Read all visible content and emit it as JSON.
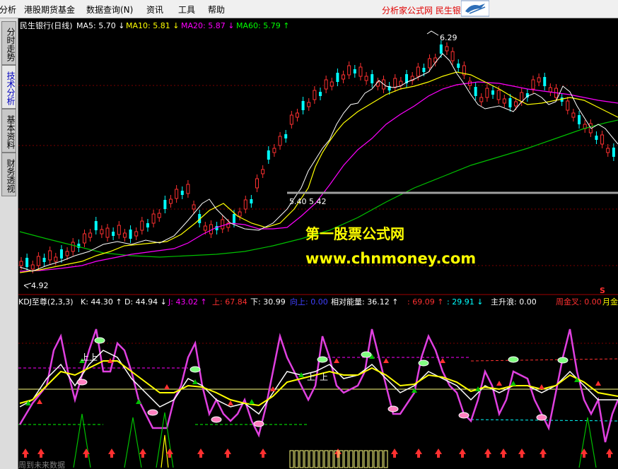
{
  "menu": {
    "items": [
      "分析",
      "港股期货基金",
      "数据查询(N)",
      "资讯",
      "工具",
      "帮助"
    ]
  },
  "brand": {
    "text": "分析家公式网 民生银行"
  },
  "sidebar": {
    "tabs": [
      "分时走势",
      "技术分析",
      "基本资料",
      "财务透视"
    ],
    "active": "技术分析"
  },
  "price_panel": {
    "stock_name": "民生银行(日线)",
    "ma": [
      {
        "label": "MA5:",
        "value": "5.70",
        "arrow": "↓",
        "color": "#ffffff"
      },
      {
        "label": "MA10:",
        "value": "5.81",
        "arrow": "↓",
        "color": "#ffff00"
      },
      {
        "label": "MA20:",
        "value": "5.87",
        "arrow": "↓",
        "color": "#ff00ff"
      },
      {
        "label": "MA60:",
        "value": "5.79",
        "arrow": "↑",
        "color": "#00ff00"
      }
    ],
    "high_label": "6.29",
    "low_label": "4.92",
    "level_label": "5.40 5.42",
    "marker": "S"
  },
  "indicator_panel": {
    "name": "KDJ至尊(2,3,3)",
    "readouts": [
      {
        "label": "K:",
        "value": "44.30",
        "arrow": "↑",
        "color": "#ffffff"
      },
      {
        "label": "D:",
        "value": "44.94",
        "arrow": "↓",
        "color": "#ffffff"
      },
      {
        "label": "J:",
        "value": "43.02",
        "arrow": "↑",
        "color": "#ff00ff"
      },
      {
        "label": "上:",
        "value": "67.84",
        "arrow": "",
        "color": "#ff3030"
      },
      {
        "label": "下:",
        "value": "30.99",
        "arrow": "",
        "color": "#ffffff"
      },
      {
        "label": "向上:",
        "value": "0.00",
        "arrow": "",
        "color": "#4040ff"
      },
      {
        "label": "相对能量:",
        "value": "36.12",
        "arrow": "↑",
        "color": "#ffffff"
      },
      {
        "label": ":",
        "value": "69.09",
        "arrow": "↑",
        "color": "#ff3030"
      },
      {
        "label": ":",
        "value": "29.91",
        "arrow": "↓",
        "color": "#00ffff"
      },
      {
        "label": "主升浪:",
        "value": "0.00",
        "arrow": "",
        "color": "#ffffff"
      },
      {
        "label": "周金叉:",
        "value": "0.00",
        "arrow": "",
        "color": "#ff3030"
      },
      {
        "label": "月金",
        "value": "",
        "arrow": "",
        "color": "#ffff00"
      }
    ],
    "footer": "周到未来数据",
    "shang_marks": [
      "上",
      "上",
      "上",
      "上"
    ]
  },
  "watermark": {
    "title": "第一股票公式网",
    "url": "www.chnmoney.com"
  },
  "colors": {
    "up": "#ff3030",
    "down": "#00ffff",
    "ma5": "#ffffff",
    "ma10": "#ffff00",
    "ma20": "#ff00ff",
    "ma60": "#00ff00"
  }
}
